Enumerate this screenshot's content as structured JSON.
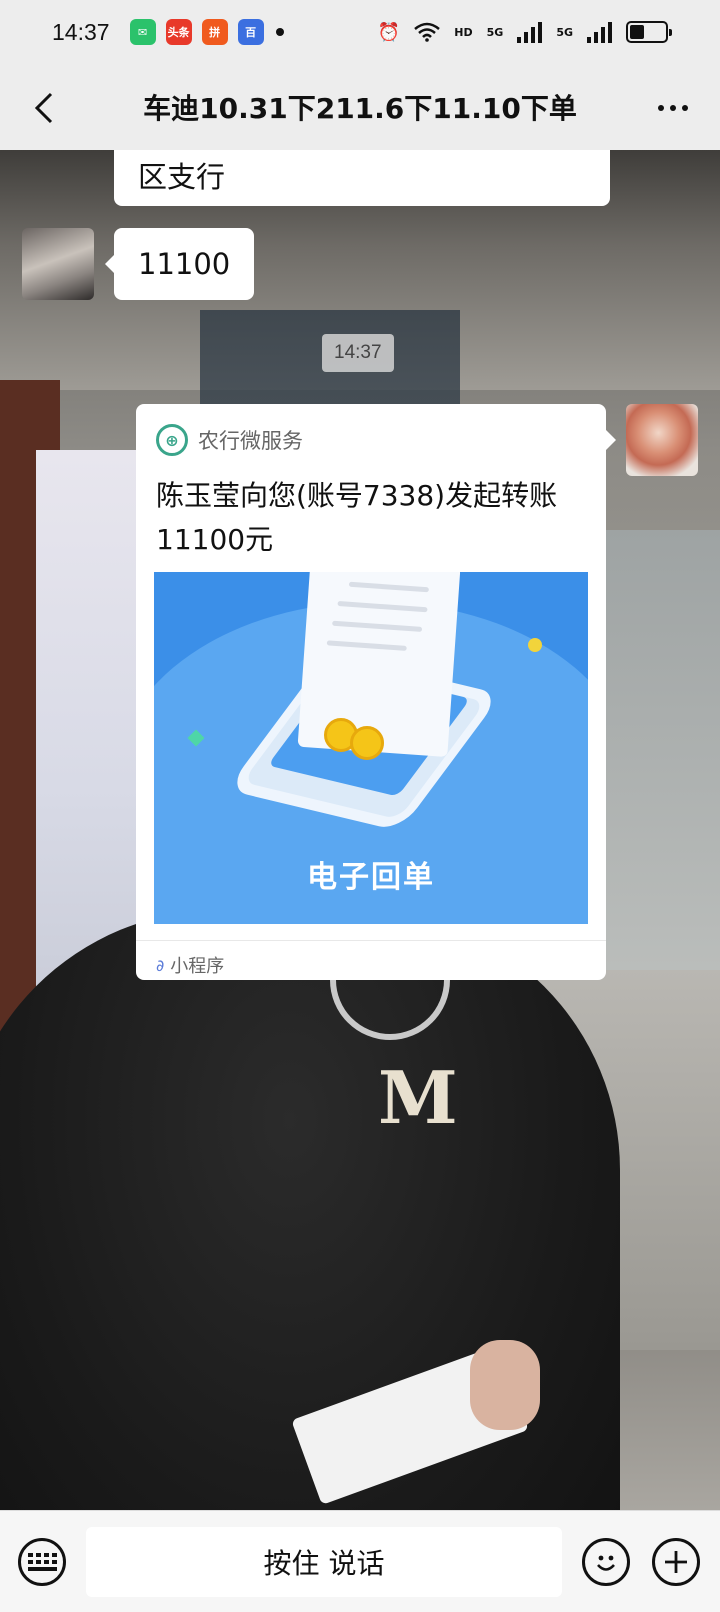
{
  "status_bar": {
    "time": "14:37",
    "apps": [
      {
        "icon": "wechat-icon",
        "glyph": "✉",
        "color": "#2bc26b"
      },
      {
        "icon": "toutiao-icon",
        "glyph": "头条",
        "color": "#e8392a"
      },
      {
        "icon": "pinduoduo-icon",
        "glyph": "拼",
        "color": "#f05a1e"
      },
      {
        "icon": "baidu-icon",
        "glyph": "百",
        "color": "#3b6fe0"
      }
    ],
    "hd_label": "HD",
    "signal_label_1": "5G",
    "signal_label_2": "5G",
    "battery_level": 0.4
  },
  "nav": {
    "title": "车迪10.31下211.6下11.10下单"
  },
  "messages": {
    "partial_text": "区支行",
    "amount_text": "11100",
    "timestamp": "14:37",
    "card": {
      "source": "农行微服务",
      "text": "陈玉莹向您(账号7338)发起转账11100元",
      "image_caption": "电子回单",
      "footer": "小程序"
    }
  },
  "input_bar": {
    "talk_label": "按住 说话"
  }
}
